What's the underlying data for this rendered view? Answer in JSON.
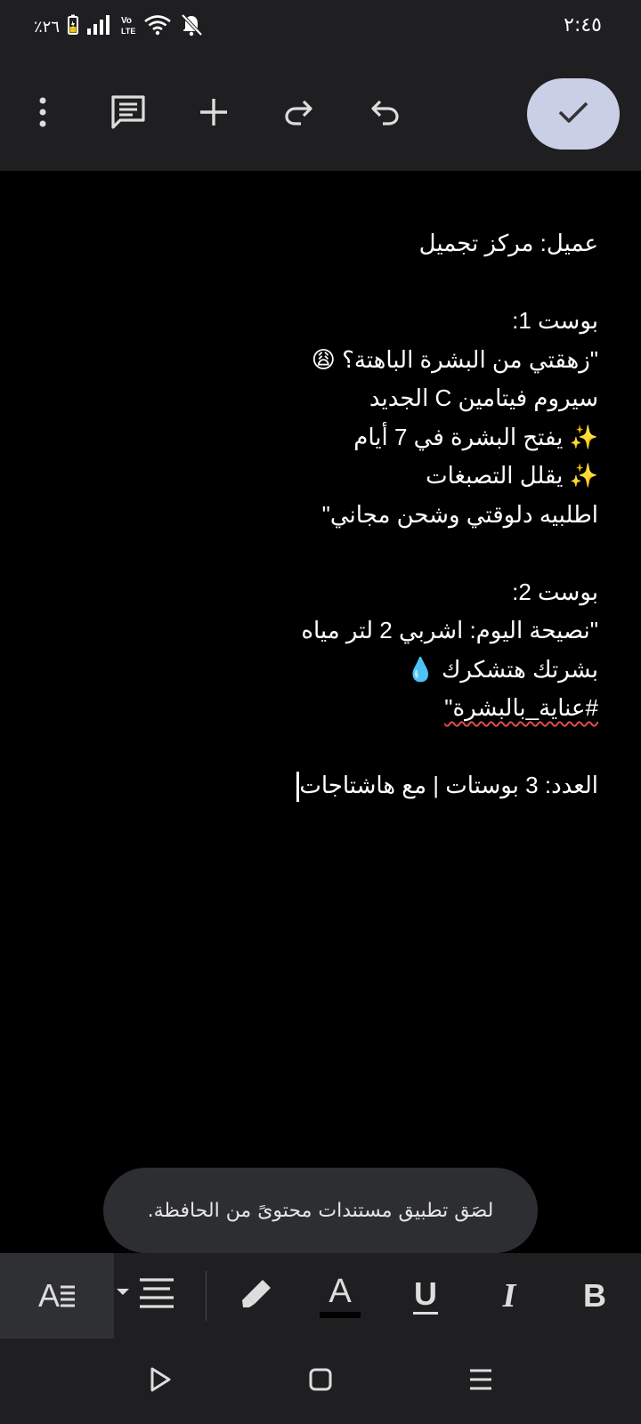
{
  "status_bar": {
    "time": "٢:٤٥",
    "battery": "٪٢٦",
    "icons": [
      "battery-icon",
      "signal-icon",
      "volte-icon",
      "wifi-icon",
      "bell-off-icon"
    ]
  },
  "toolbar": {
    "icons": [
      "more-vert-icon",
      "comment-icon",
      "add-icon",
      "redo-icon",
      "undo-icon",
      "check-icon"
    ]
  },
  "document": {
    "lines": [
      "عميل: مركز تجميل",
      "",
      "بوست 1:",
      "\"زهقتي من البشرة الباهتة؟ 😩",
      "سيروم فيتامين C الجديد",
      "✨ يفتح البشرة في 7 أيام",
      "✨ يقلل التصبغات",
      "اطلبيه دلوقتي وشحن مجاني\"",
      "",
      "بوست 2:",
      "\"نصيحة اليوم: اشربي 2 لتر مياه",
      "بشرتك هتشكرك 💧",
      "#عناية_بالبشرة\"",
      "",
      "العدد: 3 بوستات | مع هاشتاجات"
    ]
  },
  "toast": {
    "text": "لصَق تطبيق مستندات محتوىً من الحافظة."
  },
  "format_bar": {
    "icons": [
      "text-style-icon",
      "align-icon",
      "highlight-icon",
      "text-color-icon",
      "underline-icon",
      "italic-icon",
      "bold-icon"
    ],
    "text_color_glyph": "A",
    "underline_glyph": "U",
    "italic_glyph": "I",
    "bold_glyph": "B"
  },
  "nav_bar": {
    "icons": [
      "back-icon",
      "home-icon",
      "recents-icon"
    ]
  }
}
